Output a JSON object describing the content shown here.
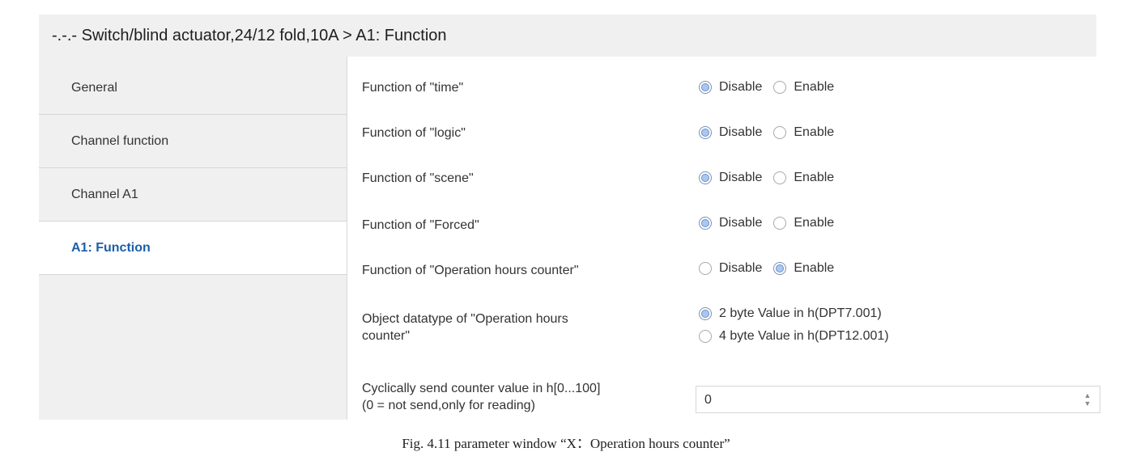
{
  "window": {
    "title": "-.-.- Switch/blind actuator,24/12 fold,10A > A1: Function"
  },
  "sidebar": {
    "items": [
      {
        "label": "General"
      },
      {
        "label": "Channel function"
      },
      {
        "label": "Channel A1"
      },
      {
        "label": "A1: Function"
      }
    ],
    "active": "A1: Function"
  },
  "params": {
    "time": {
      "label": "Function of \"time\"",
      "options": [
        "Disable",
        "Enable"
      ],
      "selected": "Disable"
    },
    "logic": {
      "label": "Function of \"logic\"",
      "options": [
        "Disable",
        "Enable"
      ],
      "selected": "Disable"
    },
    "scene": {
      "label": "Function of \"scene\"",
      "options": [
        "Disable",
        "Enable"
      ],
      "selected": "Disable"
    },
    "forced": {
      "label": "Function of \"Forced\"",
      "options": [
        "Disable",
        "Enable"
      ],
      "selected": "Disable"
    },
    "ohc": {
      "label": "Function of \"Operation hours counter\"",
      "options": [
        "Disable",
        "Enable"
      ],
      "selected": "Enable"
    },
    "datatype": {
      "label_line1": "Object datatype of \"Operation hours",
      "label_line2": "counter\"",
      "options": [
        "2 byte Value in h(DPT7.001)",
        "4 byte Value in h(DPT12.001)"
      ],
      "selected": "2 byte Value in h(DPT7.001)"
    },
    "cyclic": {
      "label_line1": "Cyclically send counter value in h[0...100]",
      "label_line2": "(0 = not send,only for reading)",
      "value": "0"
    }
  },
  "caption": "Fig. 4.11 parameter window “X：Operation hours counter”",
  "colors": {
    "accent": "#1b5fa5",
    "radio_fill": "#a9c7ef",
    "panel_bg": "#f0f0f0"
  }
}
